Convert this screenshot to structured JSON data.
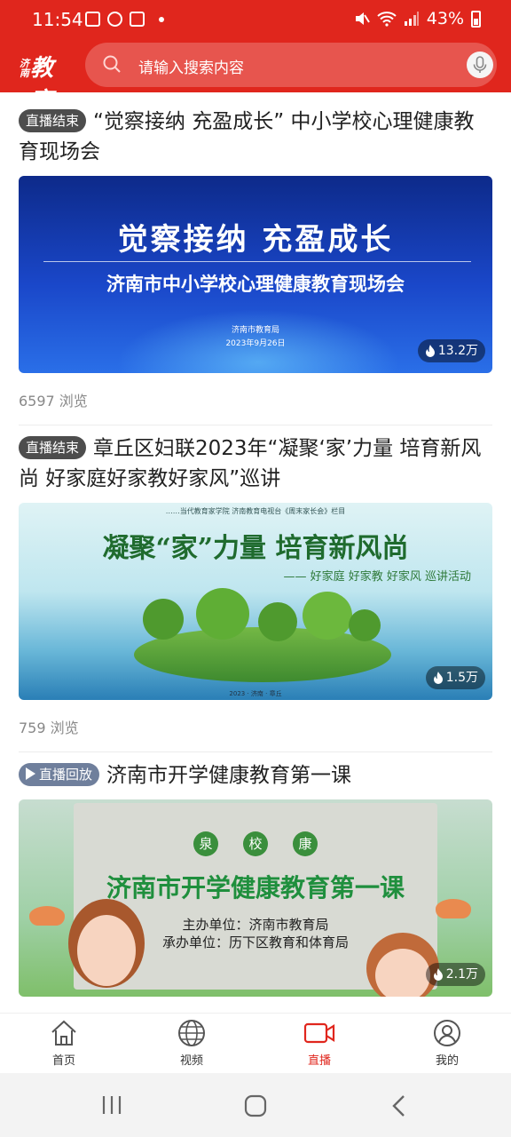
{
  "status_bar": {
    "time": "11:54",
    "battery": "43%",
    "left_icons": [
      "image-icon",
      "cloud-icon",
      "shield-icon"
    ],
    "right_icons": [
      "mute-icon",
      "wifi-icon",
      "signal-icon",
      "battery-icon"
    ]
  },
  "header": {
    "logo_text": "济南教育",
    "search_placeholder": "请输入搜索内容",
    "accent_color": "#e0261d"
  },
  "feed": [
    {
      "tag": "直播结束",
      "title": "“觉察接纳 充盈成长” 中小学校心理健康教育现场会",
      "thumb": {
        "headline": "觉察接纳  充盈成长",
        "subhead": "济南市中小学校心理健康教育现场会",
        "org": "济南市教育局",
        "date": "2023年9月26日"
      },
      "heat": "13.2万",
      "views": "6597 浏览"
    },
    {
      "tag": "直播结束",
      "title": "章丘区妇联2023年“凝聚‘家’力量 培育新风尚 好家庭好家教好家风”巡讲",
      "thumb": {
        "top_line": "……当代教育家学院  济南教育电视台《周末家长会》栏目",
        "headline": "凝聚“家”力量  培育新风尚",
        "subhead": "—— 好家庭 好家教 好家风  巡讲活动",
        "bottom_line": "2023 · 济南 · 章丘"
      },
      "heat": "1.5万",
      "views": "759 浏览"
    },
    {
      "tag": "直播回放",
      "title": "济南市开学健康教育第一课",
      "thumb": {
        "circles": [
          "泉",
          "校",
          "康"
        ],
        "headline": "济南市开学健康教育第一课",
        "line1": "主办单位：济南市教育局",
        "line2": "承办单位：历下区教育和体育局"
      },
      "heat": "2.1万"
    }
  ],
  "tabbar": [
    {
      "label": "首页",
      "icon": "home-icon",
      "active": false
    },
    {
      "label": "视频",
      "icon": "globe-icon",
      "active": false
    },
    {
      "label": "直播",
      "icon": "live-camera-icon",
      "active": true
    },
    {
      "label": "我的",
      "icon": "user-icon",
      "active": false
    }
  ],
  "system_nav": [
    "recent-apps-icon",
    "home-button-icon",
    "back-icon"
  ]
}
